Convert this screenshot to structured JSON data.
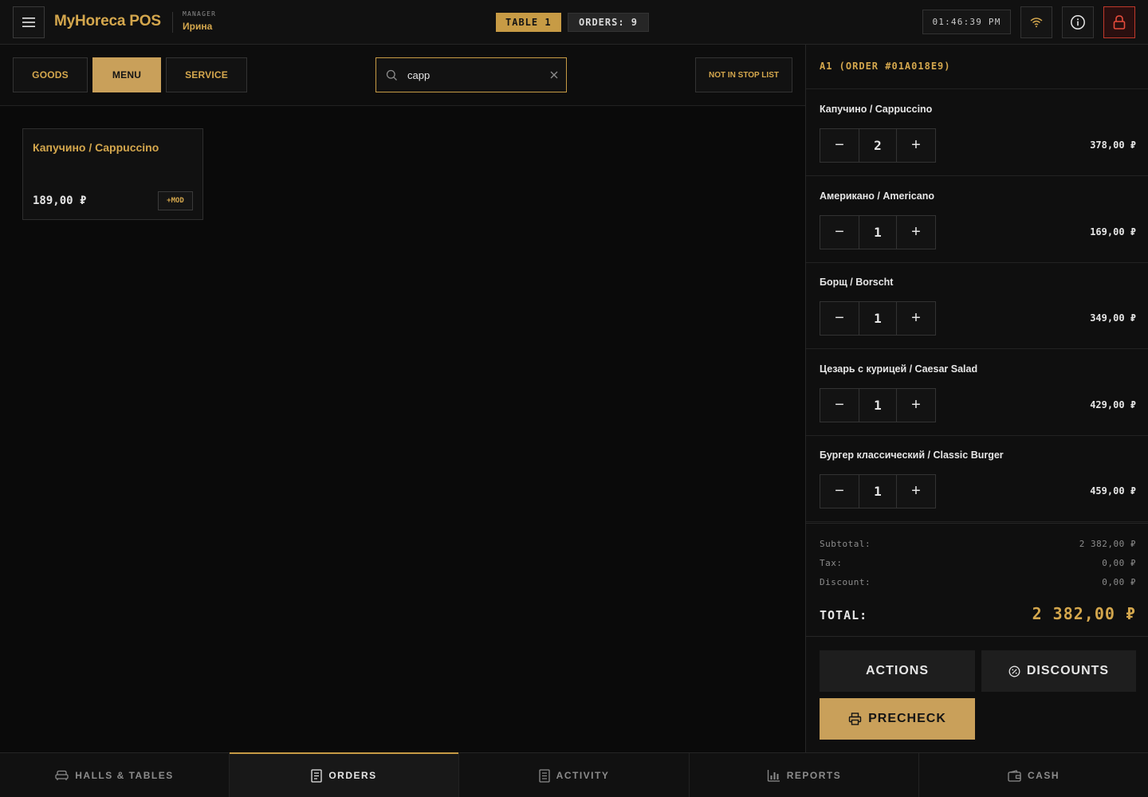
{
  "header": {
    "brand": "MyHoreca POS",
    "role": "MANAGER",
    "user": "Ирина",
    "table_badge": "TABLE 1",
    "orders_badge": "ORDERS: 9",
    "clock": "01:46:39 PM"
  },
  "toolbar": {
    "tabs": [
      {
        "label": "GOODS"
      },
      {
        "label": "MENU"
      },
      {
        "label": "SERVICE"
      }
    ],
    "search_value": "capp",
    "stoplist_label": "NOT IN STOP LIST"
  },
  "products": [
    {
      "name": "Капучино / Cappuccino",
      "price": "189,00 ₽",
      "mod_label": "+MOD"
    }
  ],
  "order": {
    "title": "A1 (ORDER #01A018E9)",
    "items": [
      {
        "name": "Капучино / Cappuccino",
        "qty": "2",
        "price": "378,00 ₽"
      },
      {
        "name": "Американо / Americano",
        "qty": "1",
        "price": "169,00 ₽"
      },
      {
        "name": "Борщ / Borscht",
        "qty": "1",
        "price": "349,00 ₽"
      },
      {
        "name": "Цезарь с курицей / Caesar Salad",
        "qty": "1",
        "price": "429,00 ₽"
      },
      {
        "name": "Бургер классический / Classic Burger",
        "qty": "1",
        "price": "459,00 ₽"
      }
    ],
    "subtotal_label": "Subtotal:",
    "subtotal": "2 382,00 ₽",
    "tax_label": "Tax:",
    "tax": "0,00 ₽",
    "discount_label": "Discount:",
    "discount": "0,00 ₽",
    "total_label": "TOTAL:",
    "total": "2 382,00 ₽",
    "actions_label": "ACTIONS",
    "discounts_label": "DISCOUNTS",
    "precheck_label": "PRECHECK"
  },
  "bottom_nav": [
    {
      "label": "HALLS & TABLES",
      "icon": "sofa-icon"
    },
    {
      "label": "ORDERS",
      "icon": "receipt-icon"
    },
    {
      "label": "ACTIVITY",
      "icon": "document-icon"
    },
    {
      "label": "REPORTS",
      "icon": "bar-chart-icon"
    },
    {
      "label": "CASH",
      "icon": "wallet-icon"
    }
  ],
  "colors": {
    "accent": "#c79b45",
    "background": "#0a0a0a",
    "panel": "#111111",
    "danger": "#c0392b"
  }
}
